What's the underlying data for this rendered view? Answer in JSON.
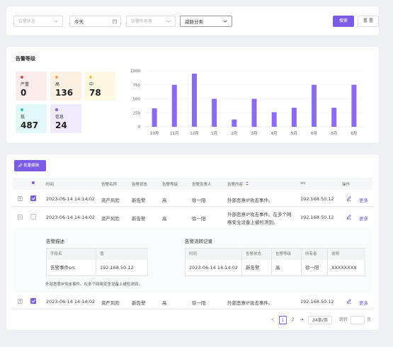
{
  "filters": {
    "status_placeholder": "告警状态",
    "date_value": "今天",
    "owner_placeholder": "告警所有者",
    "category_value": "威胁分类",
    "search_label": "搜索",
    "reset_label": "重 置"
  },
  "levels": {
    "title": "告警等级",
    "items": [
      {
        "name": "严重",
        "count": "0",
        "color": "#e5484d",
        "bg": "#fdecec"
      },
      {
        "name": "高",
        "count": "136",
        "color": "#f59e3b",
        "bg": "#fdf1e4"
      },
      {
        "name": "中",
        "count": "78",
        "color": "#f2c94c",
        "bg": "#fdf8e2"
      },
      {
        "name": "低",
        "count": "487",
        "color": "#2bc4c8",
        "bg": "#e3f8f8"
      },
      {
        "name": "信息",
        "count": "24",
        "color": "#7a5ce6",
        "bg": "#efebfc"
      }
    ]
  },
  "chart_data": {
    "type": "bar",
    "categories": [
      "10月",
      "11月",
      "12月",
      "1月",
      "2月",
      "3月",
      "4月",
      "5月",
      "6月",
      "5月",
      "6月"
    ],
    "values": [
      330,
      750,
      950,
      500,
      130,
      500,
      260,
      340,
      750,
      340,
      750
    ],
    "yticks": [
      "0",
      "250",
      "500",
      "750",
      "1000"
    ],
    "ylim": [
      0,
      1000
    ],
    "color": "#8b6cf0"
  },
  "table": {
    "batch_label": "批量编辑",
    "headers": [
      "时间",
      "告警名称",
      "告警状态",
      "告警等级",
      "告警负责人",
      "告警内容",
      "src",
      "操作"
    ],
    "rows": [
      {
        "time": "2023-06-14 14:14:02",
        "name": "资产风险",
        "status": "新告警",
        "level": "高",
        "owner": "徐一阳",
        "content": "外部恶意IP攻击事件。",
        "src": "192.168.50.12",
        "more": "更多",
        "expander": "+"
      },
      {
        "time": "2023-06-14 14:14:02",
        "name": "资产风险",
        "status": "新告警",
        "level": "高",
        "owner": "徐一阳",
        "content1": "外部恶意IP攻击事件。在多个网",
        "content2": "络安全设备上被检测到。",
        "src": "192.168.50.12",
        "more": "更多",
        "expander": "−"
      },
      {
        "time": "2023-06-14 14:14:02",
        "name": "资产风险",
        "status": "新告警",
        "level": "高",
        "owner": "徐一阳",
        "content": "外部恶意IP攻击事件。",
        "src": "192.168.50.12",
        "more": "更多",
        "expander": "+"
      }
    ],
    "detail": {
      "desc_title": "告警描述",
      "desc_headers": [
        "字段名",
        "值"
      ],
      "desc_row": [
        "告警事件src",
        "192.168.50.12"
      ],
      "note": "外部恶意IP攻击事件。在多个网络安全设备上被检测到。",
      "flow_title": "告警流转记录",
      "flow_headers": [
        "时间",
        "告警状态",
        "告警等级",
        "所有者",
        "说明"
      ],
      "flow_row": [
        "2023-06-14 14:14:02",
        "新告警",
        "高",
        "徐一阳",
        "XXXXXXXX"
      ]
    }
  },
  "pagination": {
    "prev": "<",
    "pages": [
      "1",
      "2"
    ],
    "next": "→",
    "page_size": "34条/页",
    "jump_label": "跳转",
    "page_unit": "页"
  }
}
